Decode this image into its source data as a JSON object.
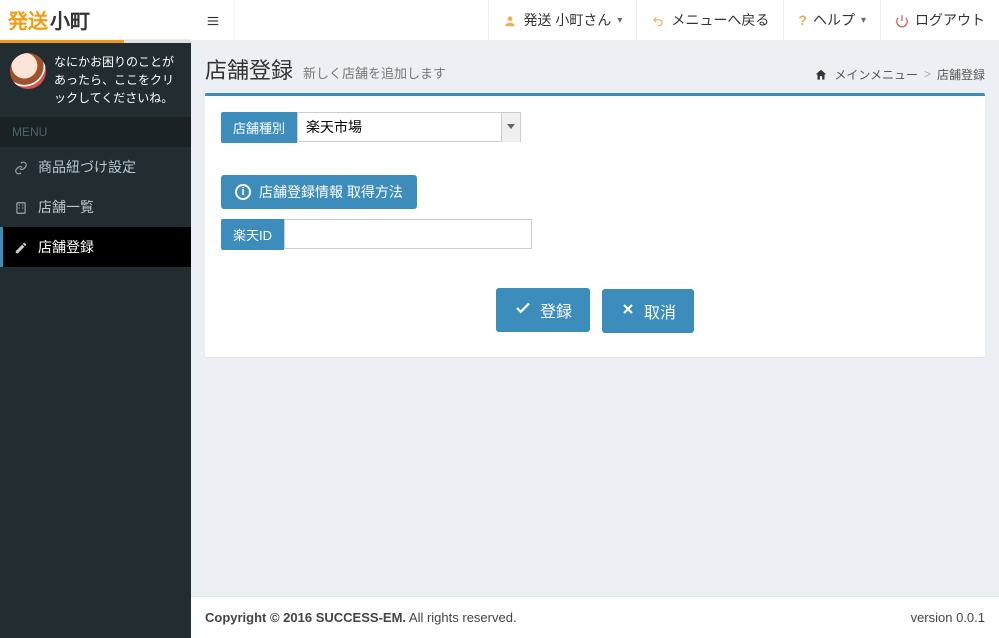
{
  "brand": {
    "part1": "発送",
    "part2": "小町"
  },
  "help_panel": {
    "text": "なにかお困りのことがあったら、ここをクリックしてくださいね。"
  },
  "sidebar": {
    "header": "MENU",
    "items": [
      {
        "label": "商品紐づけ設定",
        "icon": "link-icon"
      },
      {
        "label": "店舗一覧",
        "icon": "building-icon"
      },
      {
        "label": "店舗登録",
        "icon": "pencil-icon"
      }
    ]
  },
  "nav": {
    "user": "発送 小町さん",
    "back": "メニューへ戻る",
    "help": "ヘルプ",
    "logout": "ログアウト"
  },
  "page": {
    "title": "店舗登録",
    "subtitle": "新しく店舗を追加します"
  },
  "breadcrumb": {
    "root": "メインメニュー",
    "current": "店舗登録",
    "separator": ">"
  },
  "form": {
    "store_type_label": "店舗種別",
    "store_type_value": "楽天市場",
    "info_button": "店舗登録情報 取得方法",
    "rakuten_id_label": "楽天ID",
    "rakuten_id_value": "",
    "submit": "登録",
    "cancel": "取消"
  },
  "footer": {
    "copyright_bold": "Copyright © 2016 SUCCESS-EM.",
    "copyright_rest": " All rights reserved.",
    "version": "version 0.0.1"
  }
}
